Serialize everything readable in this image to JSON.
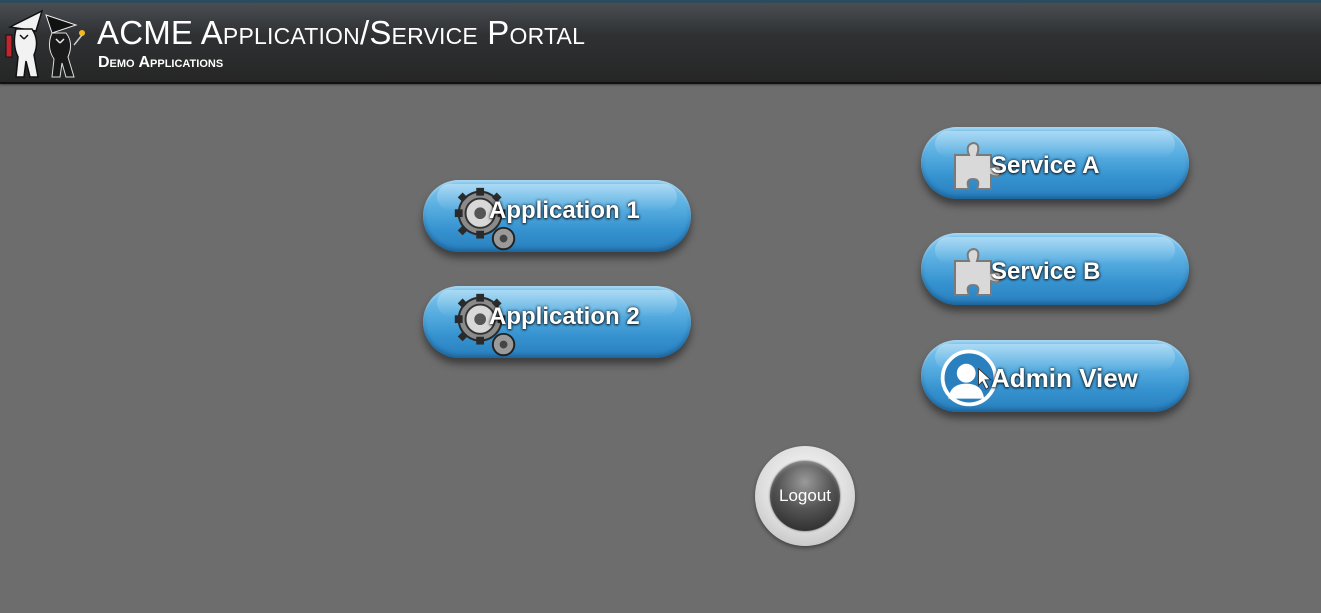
{
  "header": {
    "title": "ACME Application/Service Portal",
    "subtitle": "Demo Applications",
    "logo_icon": "spy-vs-spy-logo-icon"
  },
  "apps": [
    {
      "label": "Application 1",
      "icon": "gears-icon"
    },
    {
      "label": "Application 2",
      "icon": "gears-icon"
    }
  ],
  "services": [
    {
      "label": "Service A",
      "icon": "puzzle-piece-icon"
    },
    {
      "label": "Service B",
      "icon": "puzzle-piece-icon"
    }
  ],
  "admin": {
    "label": "Admin View",
    "icon": "user-cursor-icon"
  },
  "logout": {
    "label": "Logout"
  },
  "colors": {
    "background": "#6d6d6d",
    "header": "#2f3133",
    "button_blue": "#3592cf",
    "button_blue_light": "#84c9f0"
  }
}
